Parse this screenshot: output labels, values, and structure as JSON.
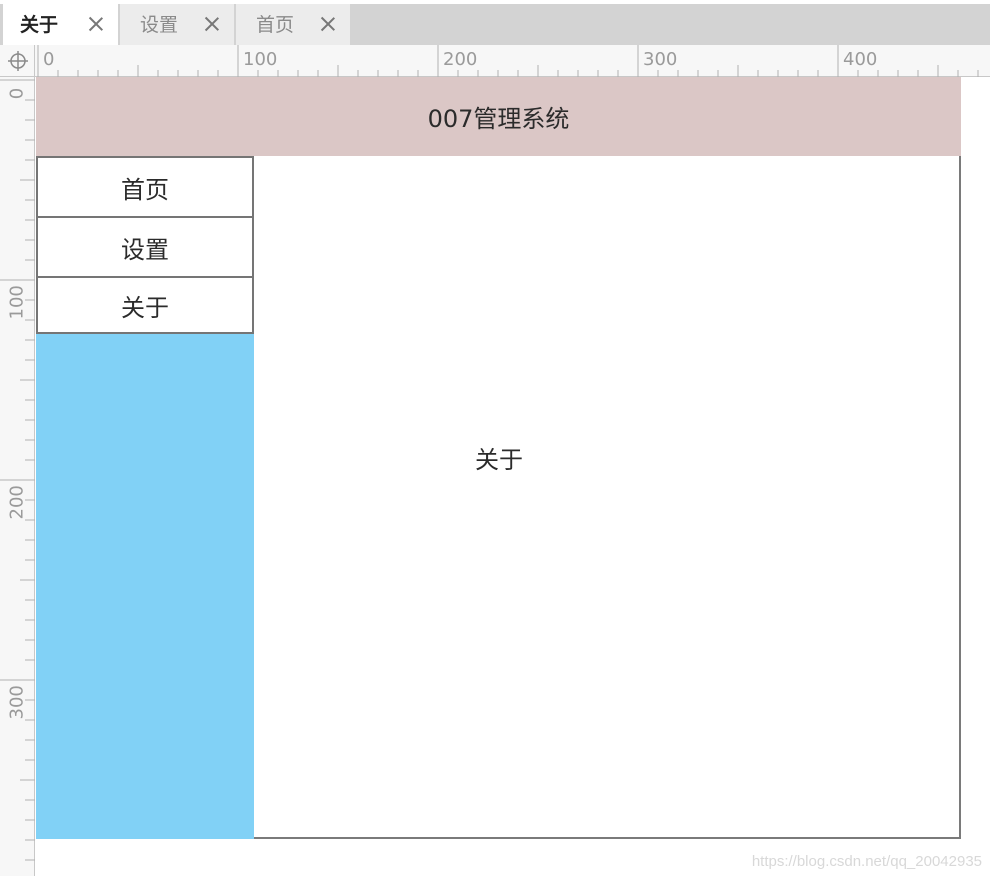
{
  "tabs": [
    {
      "label": "关于",
      "active": true
    },
    {
      "label": "设置",
      "active": false
    },
    {
      "label": "首页",
      "active": false
    }
  ],
  "ruler": {
    "top_labels": [
      "0",
      "100",
      "200",
      "300",
      "400"
    ],
    "left_labels": [
      "0",
      "100",
      "200",
      "300"
    ]
  },
  "app": {
    "title": "007管理系统",
    "menu": [
      "首页",
      "设置",
      "关于"
    ],
    "main_text": "关于"
  },
  "watermark": "https://blog.csdn.net/qq_20042935",
  "colors": {
    "header_bg": "#dbc7c6",
    "sidebar_bg": "#81d1f6",
    "tabbar_bg": "#d3d3d3"
  }
}
